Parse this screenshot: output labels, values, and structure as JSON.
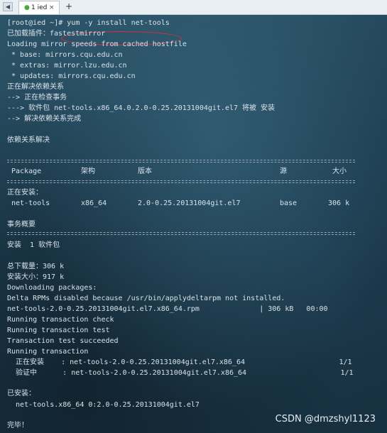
{
  "tabbar": {
    "nav_icon": "menu-arrow-icon",
    "tab_label": "1 ied",
    "tab_close": "×",
    "add_label": "+"
  },
  "terminal": {
    "lines": [
      "[root@ied ~]# yum -y install net-tools",
      "已加载插件：fastestmirror",
      "Loading mirror speeds from cached hostfile",
      " * base: mirrors.cqu.edu.cn",
      " * extras: mirror.lzu.edu.cn",
      " * updates: mirrors.cqu.edu.cn",
      "正在解决依赖关系",
      "--> 正在检查事务",
      "---> 软件包 net-tools.x86_64.0.2.0-0.25.20131004git.el7 将被 安装",
      "--> 解决依赖关系完成",
      "依赖关系解决",
      "正在安装：",
      "事务概要",
      "安装  1 软件包",
      "总下载量：306 k",
      "安装大小：917 k",
      "Downloading packages:",
      "Delta RPMs disabled because /usr/bin/applydeltarpm not installed.",
      "net-tools-2.0-0.25.20131004git.el7.x86_64.rpm              | 306 kB   00:00",
      "Running transaction check",
      "Running transaction test",
      "Transaction test succeeded",
      "Running transaction",
      "  正在安装    : net-tools-2.0-0.25.20131004git.el7.x86_64                      1/1",
      "  验证中      : net-tools-2.0-0.25.20131004git.el7.x86_64                      1/1",
      "已安装：",
      "  net-tools.x86_64 0:2.0-0.25.20131004git.el7",
      "完毕！"
    ],
    "table": {
      "headers": [
        "Package",
        "架构",
        "版本",
        "源",
        "大小"
      ],
      "row": [
        "net-tools",
        "x86_64",
        "2.0-0.25.20131004git.el7",
        "base",
        "306 k"
      ]
    }
  },
  "watermark": "CSDN @dmzshyl1123"
}
